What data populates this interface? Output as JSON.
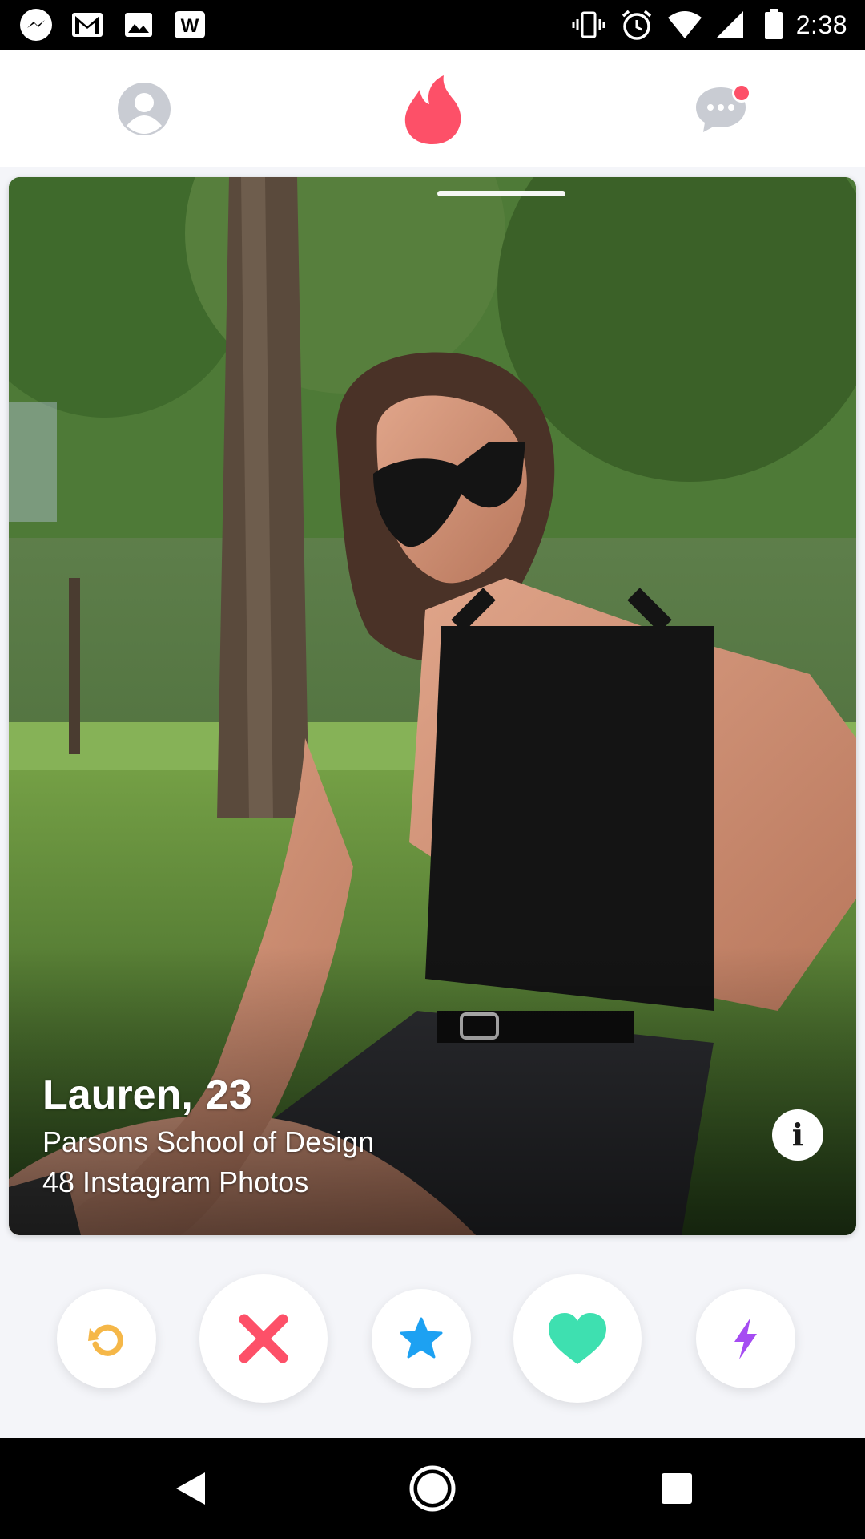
{
  "status_bar": {
    "time": "2:38",
    "left_icons": [
      "messenger-icon",
      "gmail-icon",
      "image-icon",
      "word-icon"
    ],
    "right_icons": [
      "vibrate-icon",
      "alarm-icon",
      "wifi-icon",
      "signal-icon",
      "battery-icon"
    ]
  },
  "top_nav": {
    "items": [
      "profile-icon",
      "flame-icon",
      "chat-icon"
    ],
    "accent_color": "#fd5068",
    "chat_has_notification": true
  },
  "card": {
    "name": "Lauren,",
    "age": "23",
    "school": "Parsons School of Design",
    "instagram": "48 Instagram Photos",
    "photo_count_shown": 1
  },
  "actions": [
    {
      "name": "rewind",
      "color": "#f5b748"
    },
    {
      "name": "nope",
      "color": "#fd5068"
    },
    {
      "name": "super-like",
      "color": "#1da1f2"
    },
    {
      "name": "like",
      "color": "#3ee0b0"
    },
    {
      "name": "boost",
      "color": "#a54cf2"
    }
  ]
}
